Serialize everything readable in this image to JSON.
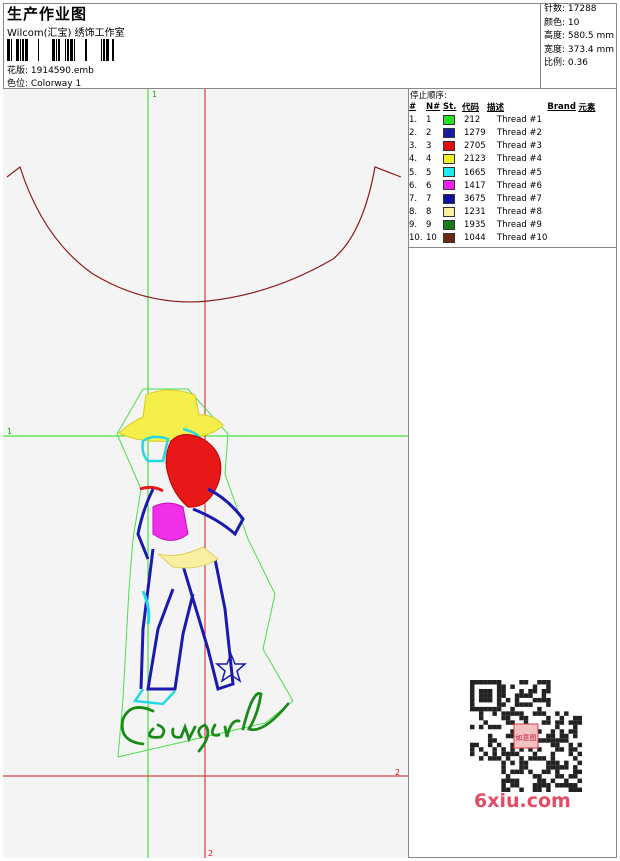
{
  "header": {
    "title": "生产作业图",
    "company": "Wilcom(汇宝) 绣饰工作室",
    "file_label": "花版: 1914590.emb",
    "colorway_label": "色位: Colorway 1"
  },
  "stats": {
    "stitches": "针数: 17288",
    "colors": "颜色: 10",
    "height": "高度: 580.5 mm",
    "width": "宽度: 373.4 mm",
    "scale": "比例: 0.36"
  },
  "canvas": {
    "guide_label_top": "1",
    "guide_label_left": "1",
    "guide_label_right": "2",
    "guide_label_bottom": "2",
    "colors": {
      "background": "#f5f4f4",
      "guide_green": "#19e019",
      "guide_red": "#d01818",
      "outline": "#8b1a1a"
    }
  },
  "thread_panel": {
    "title": "停止顺序:",
    "columns": [
      "#",
      "N#",
      "St.",
      "代码",
      "描述",
      "Brand",
      "元素"
    ],
    "rows": [
      {
        "index": "1.",
        "n": "1",
        "color": "#22e022",
        "code": "212",
        "desc": "Thread #1"
      },
      {
        "index": "2.",
        "n": "2",
        "color": "#1a1aa0",
        "code": "1279",
        "desc": "Thread #2"
      },
      {
        "index": "3.",
        "n": "3",
        "color": "#e01010",
        "code": "2705",
        "desc": "Thread #3"
      },
      {
        "index": "4.",
        "n": "4",
        "color": "#f0f020",
        "code": "2123",
        "desc": "Thread #4"
      },
      {
        "index": "5.",
        "n": "5",
        "color": "#22e8f0",
        "code": "1665",
        "desc": "Thread #5"
      },
      {
        "index": "6.",
        "n": "6",
        "color": "#f020f0",
        "code": "1417",
        "desc": "Thread #6"
      },
      {
        "index": "7.",
        "n": "7",
        "color": "#1010a0",
        "code": "3675",
        "desc": "Thread #7"
      },
      {
        "index": "8.",
        "n": "8",
        "color": "#f8f0a0",
        "code": "1231",
        "desc": "Thread #8"
      },
      {
        "index": "9.",
        "n": "9",
        "color": "#1a7a1a",
        "code": "1935",
        "desc": "Thread #9"
      },
      {
        "index": "10.",
        "n": "10",
        "color": "#6a2a10",
        "code": "1044",
        "desc": "Thread #10"
      }
    ]
  },
  "watermark": {
    "logo_text": "6xiu.com",
    "seal_text": "如意图"
  }
}
